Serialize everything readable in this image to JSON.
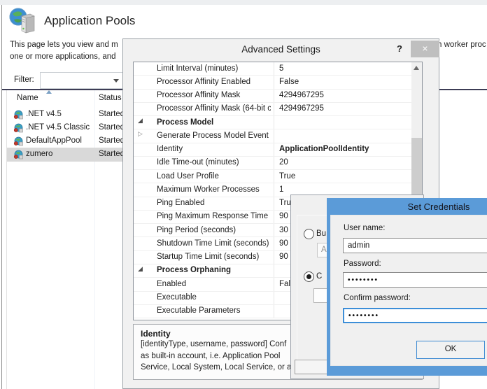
{
  "colors": {
    "accent_blue": "#5b9bd8",
    "focus_blue": "#3c8ed8",
    "selection_gray": "#d9d9d9",
    "close_btn_gray": "#bfbfbf",
    "header_line_navy": "#3c3c55"
  },
  "background": {
    "title": "Application Pools",
    "description_line1": "This page lets you view and m",
    "description_line2": "one or more applications, and",
    "description_fragment_right": "h worker proc",
    "filter_label": "Filter:",
    "table": {
      "columns": [
        "Name",
        "Status"
      ],
      "rows": [
        {
          "name": ".NET v4.5",
          "status": "Started",
          "selected": false
        },
        {
          "name": ".NET v4.5 Classic",
          "status": "Started",
          "selected": false
        },
        {
          "name": "DefaultAppPool",
          "status": "Started",
          "selected": false
        },
        {
          "name": "zumero",
          "status": "Started",
          "selected": true
        }
      ]
    }
  },
  "advanced_settings": {
    "title": "Advanced Settings",
    "help_label": "?",
    "close_label": "×",
    "grid_rows": [
      {
        "label": "Limit Interval (minutes)",
        "value": "5",
        "type": "item"
      },
      {
        "label": "Processor Affinity Enabled",
        "value": "False",
        "type": "item"
      },
      {
        "label": "Processor Affinity Mask",
        "value": "4294967295",
        "type": "item"
      },
      {
        "label": "Processor Affinity Mask (64-bit c",
        "value": "4294967295",
        "type": "item"
      },
      {
        "label": "Process Model",
        "value": "",
        "type": "section"
      },
      {
        "label": "Generate Process Model Event L",
        "value": "",
        "type": "subitem"
      },
      {
        "label": "Identity",
        "value": "ApplicationPoolIdentity",
        "type": "item",
        "value_bold": true
      },
      {
        "label": "Idle Time-out (minutes)",
        "value": "20",
        "type": "item"
      },
      {
        "label": "Load User Profile",
        "value": "True",
        "type": "item"
      },
      {
        "label": "Maximum Worker Processes",
        "value": "1",
        "type": "item"
      },
      {
        "label": "Ping Enabled",
        "value": "True",
        "type": "item"
      },
      {
        "label": "Ping Maximum Response Time (",
        "value": "90",
        "type": "item"
      },
      {
        "label": "Ping Period (seconds)",
        "value": "30",
        "type": "item"
      },
      {
        "label": "Shutdown Time Limit (seconds)",
        "value": "90",
        "type": "item"
      },
      {
        "label": "Startup Time Limit (seconds)",
        "value": "90",
        "type": "item"
      },
      {
        "label": "Process Orphaning",
        "value": "",
        "type": "section"
      },
      {
        "label": "Enabled",
        "value": "False",
        "type": "item"
      },
      {
        "label": "Executable",
        "value": "",
        "type": "item"
      },
      {
        "label": "Executable Parameters",
        "value": "",
        "type": "item"
      }
    ],
    "expanded_glyph": "◢",
    "collapsed_glyph": "▷",
    "description": {
      "title": "Identity",
      "lines": [
        "[identityType, username, password] Conf",
        "as built-in account, i.e. Application Pool",
        "Service, Local System, Local Service, or as"
      ]
    }
  },
  "identity_dialog": {
    "builtin_radio_fragment": "Bu",
    "builtin_combo_fragment": "A",
    "custom_radio_fragment": "C"
  },
  "credentials_dialog": {
    "title": "Set Credentials",
    "username_label": "User name:",
    "username_value": "admin",
    "password_label": "Password:",
    "password_value": "••••••••",
    "confirm_label": "Confirm password:",
    "confirm_value": "••••••••",
    "ok_label": "OK"
  }
}
